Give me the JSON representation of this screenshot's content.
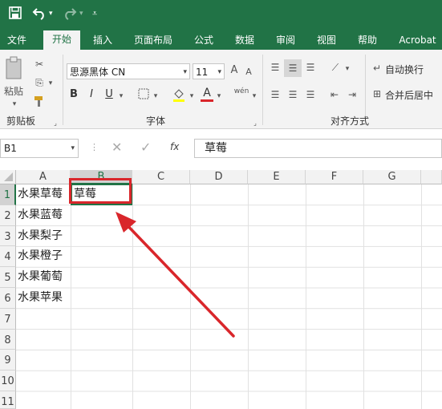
{
  "qat": {
    "save_icon": "save-icon",
    "undo_icon": "undo-icon",
    "redo_icon": "redo-icon",
    "customize_icon": "customize-icon"
  },
  "tabs": [
    {
      "label": "文件"
    },
    {
      "label": "开始"
    },
    {
      "label": "插入"
    },
    {
      "label": "页面布局"
    },
    {
      "label": "公式"
    },
    {
      "label": "数据"
    },
    {
      "label": "审阅"
    },
    {
      "label": "视图"
    },
    {
      "label": "帮助"
    },
    {
      "label": "Acrobat"
    }
  ],
  "ribbon": {
    "clipboard": {
      "paste_label": "粘贴",
      "group_label": "剪贴板"
    },
    "font": {
      "font_name": "思源黑体 CN",
      "font_size": "11",
      "group_label": "字体",
      "bold": "B",
      "italic": "I",
      "underline": "U",
      "grow": "A",
      "shrink": "A",
      "font_color_glyph": "A",
      "phonetic": "wén"
    },
    "alignment": {
      "wrap_label": "自动换行",
      "merge_label": "合并后居中",
      "group_label": "对齐方式"
    }
  },
  "formula_bar": {
    "name_box": "B1",
    "fx_label": "fx",
    "value": "草莓"
  },
  "columns": [
    "A",
    "B",
    "C",
    "D",
    "E",
    "F",
    "G"
  ],
  "rows": [
    "1",
    "2",
    "3",
    "4",
    "5",
    "6",
    "7",
    "8",
    "9",
    "10",
    "11"
  ],
  "cells": {
    "A": [
      "水果草莓",
      "水果蓝莓",
      "水果梨子",
      "水果橙子",
      "水果葡萄",
      "水果苹果"
    ],
    "B1": "草莓"
  },
  "colors": {
    "excel_green": "#217346",
    "highlight_red": "#d9262b"
  }
}
